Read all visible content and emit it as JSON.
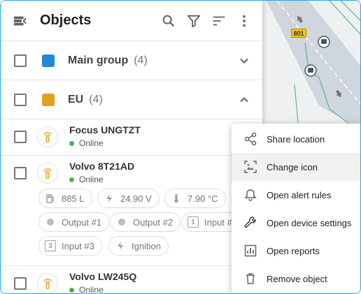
{
  "header": {
    "title": "Objects",
    "icons": [
      "menu-collapse-icon",
      "search-icon",
      "filter-icon",
      "sort-icon",
      "more-vert-icon"
    ]
  },
  "groups": [
    {
      "name": "Main group",
      "count": "(4)",
      "color": "#1e88d9",
      "expanded": false
    },
    {
      "name": "EU",
      "count": "(4)",
      "color": "#e0a020",
      "expanded": true
    }
  ],
  "objects": [
    {
      "name": "Focus UNGTZT",
      "status": "Online"
    },
    {
      "name": "Volvo 8T21AD",
      "status": "Online",
      "sensors": {
        "fuel": "885 L",
        "voltage": "24.90 V",
        "temperature": "7.90 °C",
        "output1": "Output #1",
        "output2": "Output #2",
        "input1": "Input #",
        "input3": "Input #3",
        "ignition": "Ignition",
        "input1_box": "1",
        "input3_box": "3"
      }
    },
    {
      "name": "Volvo LW245Q",
      "status": "Online"
    }
  ],
  "context_menu": {
    "items": [
      {
        "label": "Share location",
        "icon": "share-icon"
      },
      {
        "label": "Change icon",
        "icon": "image-icon",
        "highlighted": true
      },
      {
        "label": "Open alert rules",
        "icon": "bell-icon"
      },
      {
        "label": "Open device settings",
        "icon": "wrench-icon"
      },
      {
        "label": "Open reports",
        "icon": "chart-icon"
      },
      {
        "label": "Remove object",
        "icon": "trash-icon"
      }
    ]
  },
  "map": {
    "road_badge": "801"
  },
  "colors": {
    "accent": "#28a8e0",
    "online": "#4caf50",
    "tracker": "#e0a020"
  }
}
